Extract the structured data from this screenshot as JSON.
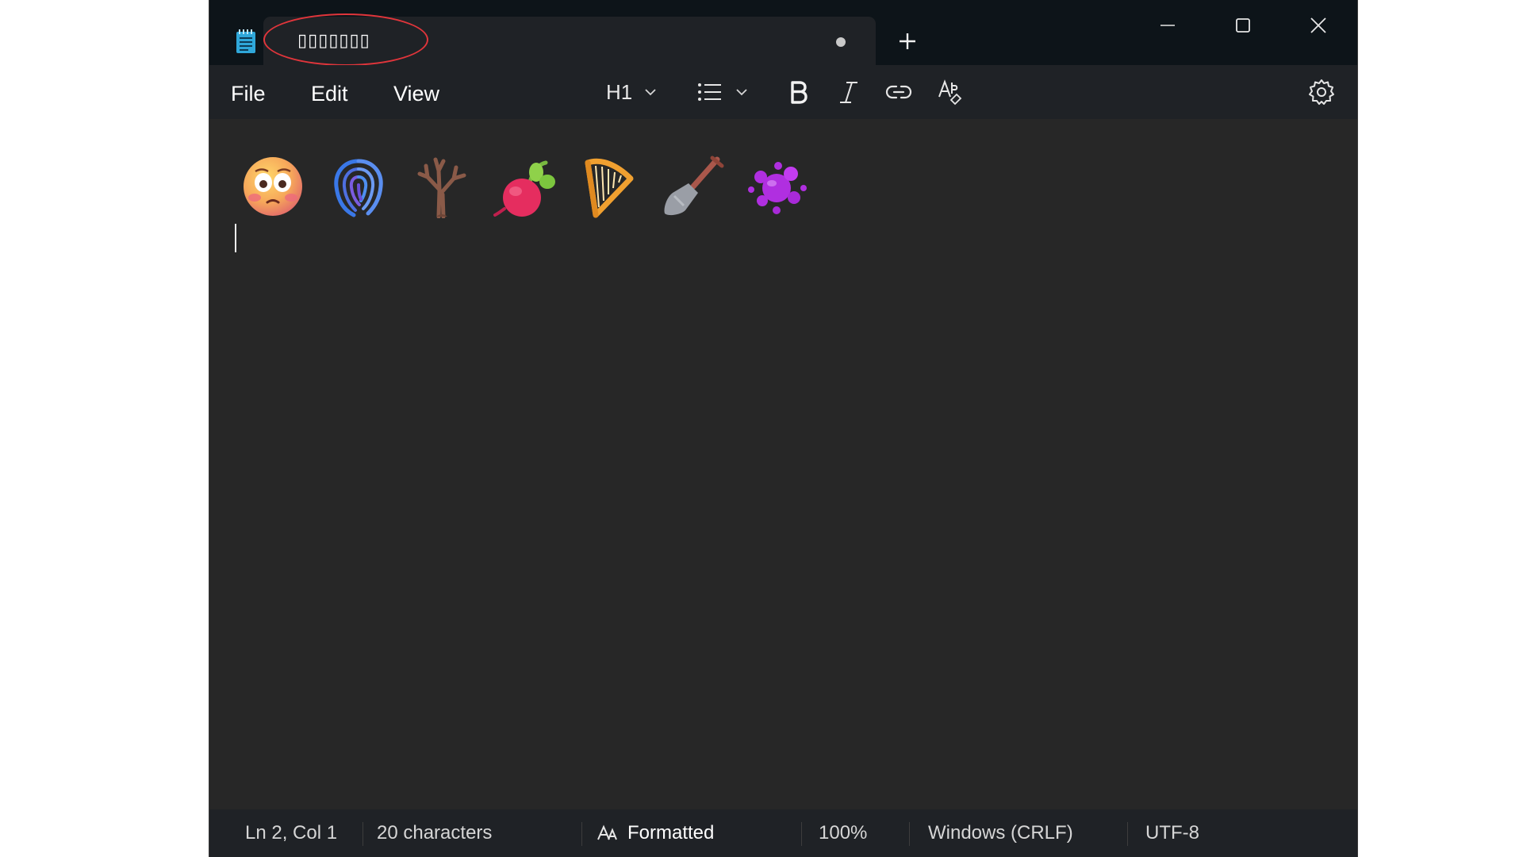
{
  "tab": {
    "title": "▯▯▯▯▯▯▯",
    "unsaved_indicator": "●"
  },
  "window_controls": {
    "minimize": "minimize",
    "maximize": "maximize",
    "close": "close"
  },
  "menu": {
    "file": "File",
    "edit": "Edit",
    "view": "View"
  },
  "toolbar": {
    "heading_label": "H1"
  },
  "editor": {
    "emoji_icons": [
      "flushed-face-icon",
      "fingerprint-icon",
      "leafless-tree-icon",
      "beet-icon",
      "harp-icon",
      "shovel-icon",
      "splatter-icon"
    ]
  },
  "status": {
    "position": "Ln 2, Col 1",
    "characters": "20 characters",
    "format": "Formatted",
    "zoom": "100%",
    "line_ending": "Windows (CRLF)",
    "encoding": "UTF-8"
  },
  "colors": {
    "titlebar": "#0d1419",
    "toolbar": "#1f2226",
    "editor": "#272727",
    "highlight": "#e0353b"
  }
}
